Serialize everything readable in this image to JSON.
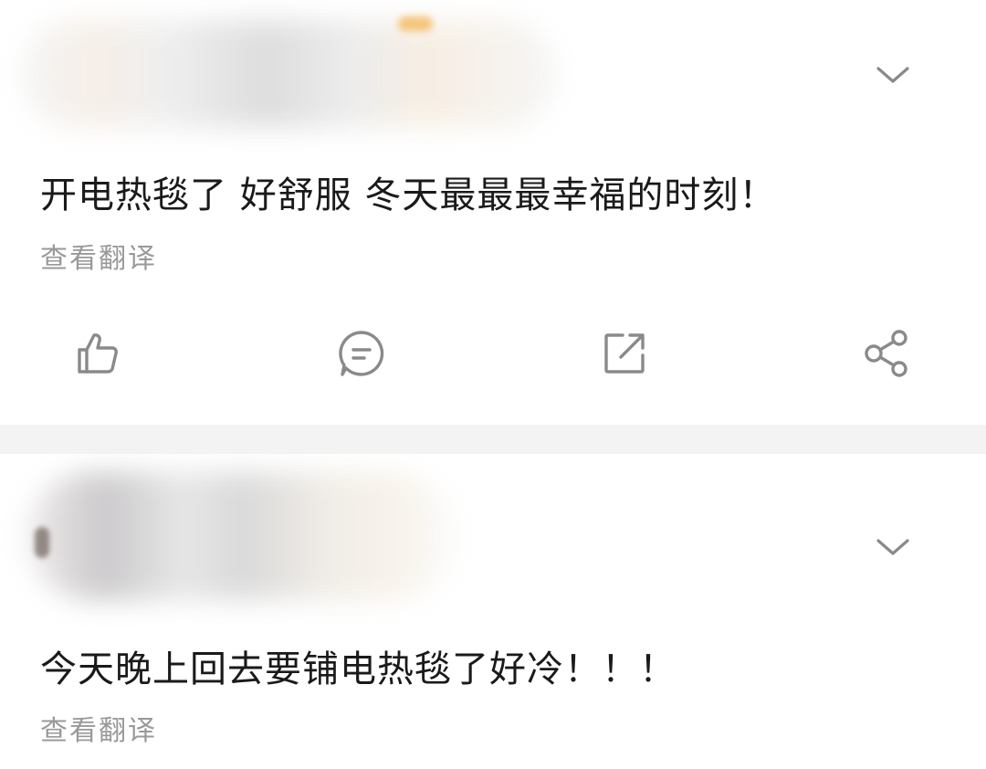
{
  "posts": [
    {
      "text": "开电热毯了 好舒服 冬天最最最幸福的时刻！",
      "translate_label": "查看翻译",
      "actions": [
        "like-icon",
        "comment-icon",
        "repost-icon",
        "share-icon"
      ]
    },
    {
      "text": "今天晚上回去要铺电热毯了好冷！！！",
      "translate_label": "查看翻译"
    }
  ],
  "icons": {
    "more": "chevron-down-icon"
  },
  "colors": {
    "text": "#1a1a1a",
    "secondary_text": "#999999",
    "icon": "#8a8a8a",
    "separator": "#f3f3f3"
  }
}
